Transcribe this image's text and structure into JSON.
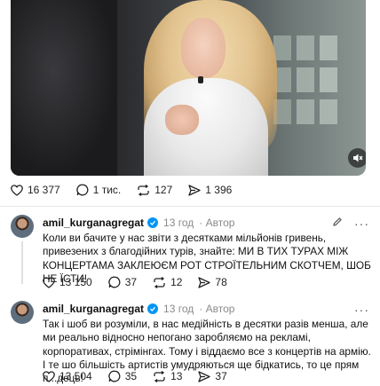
{
  "media": {
    "sound_icon": "speaker-muted-icon"
  },
  "top_actions": {
    "likes": "16 377",
    "comments": "1 тис.",
    "reposts": "127",
    "shares": "1 396"
  },
  "posts": [
    {
      "username": "amil_kurganagregat",
      "time": "13 год",
      "role": "Автор",
      "more": "···",
      "text": "Коли ви бачите у нас звіти з десятками мільйонів гривень, привезених з благодійних турів, знайте: МИ В ТИХ ТУРАХ МІЖ КОНЦЕРТАМА ЗАКЛЕЮЄМ РОТ СТРОЇТЕЛЬНИМ СКОТЧЕМ, ШОБ НЕ ЇСТИ!",
      "likes": "13 150",
      "comments": "37",
      "reposts": "12",
      "shares": "78"
    },
    {
      "username": "amil_kurganagregat",
      "time": "13 год",
      "role": "Автор",
      "more": "···",
      "text": "Так і шоб ви розуміли, в нас медійність в десятки разів менша, але ми реально відносно непогано заробляємо на рекламі, корпоративах, стрімінгах. Тому і віддаємо все з концертів на армію. І те шо більшість артистів умудряються ще бідкатись, то це прям п...дець!",
      "likes": "13 504",
      "comments": "35",
      "reposts": "13",
      "shares": "37"
    }
  ],
  "colors": {
    "verified": "#0095f6",
    "meta": "#8a8a8a"
  }
}
